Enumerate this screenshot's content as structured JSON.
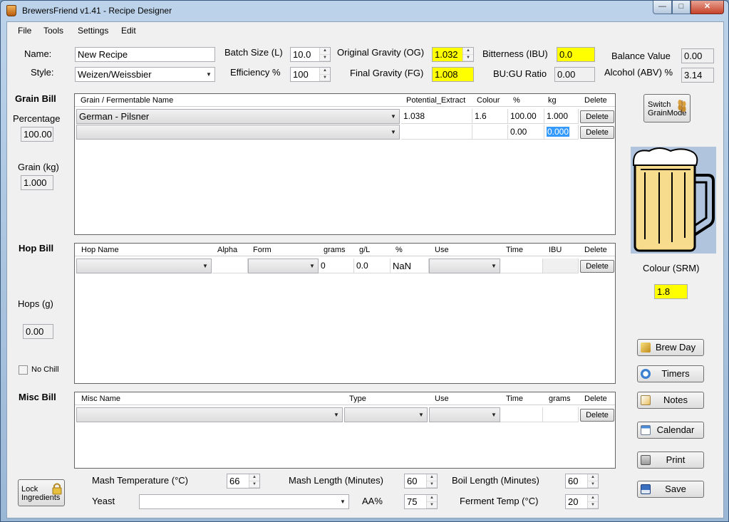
{
  "window": {
    "title": "BrewersFriend v1.41 - Recipe Designer",
    "minimize": "—",
    "maximize": "□",
    "close": "✕"
  },
  "menu": [
    "File",
    "Tools",
    "Settings",
    "Edit"
  ],
  "recipe": {
    "name_label": "Name:",
    "name_value": "New Recipe",
    "style_label": "Style:",
    "style_value": "Weizen/Weissbier",
    "batch_label": "Batch Size (L)",
    "batch_value": "10.0",
    "eff_label": "Efficiency %",
    "eff_value": "100",
    "og_label": "Original Gravity (OG)",
    "og_value": "1.032",
    "fg_label": "Final Gravity (FG)",
    "fg_value": "1.008",
    "ibu_label": "Bitterness (IBU)",
    "ibu_value": "0.0",
    "bugu_label": "BU:GU Ratio",
    "bugu_value": "0.00",
    "balance_label": "Balance Value",
    "balance_value": "0.00",
    "abv_label": "Alcohol (ABV) %",
    "abv_value": "3.14"
  },
  "grain": {
    "title": "Grain Bill",
    "pct_label": "Percentage",
    "pct_value": "100.00",
    "kg_label": "Grain (kg)",
    "kg_value": "1.000",
    "columns": [
      "Grain / Fermentable Name",
      "Potential_Extract",
      "Colour",
      "%",
      "kg",
      "Delete"
    ],
    "rows": [
      {
        "name": "German - Pilsner",
        "extract": "1.038",
        "colour": "1.6",
        "pct": "100.00",
        "kg": "1.000",
        "delete": "Delete"
      },
      {
        "name": "",
        "extract": "",
        "colour": "",
        "pct": "0.00",
        "kg": "0.000",
        "delete": "Delete"
      }
    ]
  },
  "hop": {
    "title": "Hop Bill",
    "hops_label": "Hops (g)",
    "hops_value": "0.00",
    "nochill": "No Chill",
    "columns": [
      "Hop Name",
      "Alpha",
      "Form",
      "grams",
      "g/L",
      "%",
      "Use",
      "Time",
      "IBU",
      "Delete"
    ],
    "row": {
      "grams": "0",
      "gl": "0.0",
      "pct": "NaN",
      "delete": "Delete"
    }
  },
  "misc": {
    "title": "Misc Bill",
    "columns": [
      "Misc Name",
      "Type",
      "Use",
      "Time",
      "grams",
      "Delete"
    ],
    "row": {
      "delete": "Delete"
    }
  },
  "side": {
    "switch_line1": "Switch",
    "switch_line2": "GrainMode",
    "colour_label": "Colour (SRM)",
    "colour_value": "1.8",
    "buttons": [
      "Brew Day",
      "Timers",
      "Notes",
      "Calendar",
      "Print",
      "Save"
    ]
  },
  "bottom": {
    "lock_line1": "Lock",
    "lock_line2": "Ingredients",
    "mash_temp_label": "Mash Temperature (°C)",
    "mash_temp_value": "66",
    "mash_len_label": "Mash Length (Minutes)",
    "mash_len_value": "60",
    "boil_len_label": "Boil Length (Minutes)",
    "boil_len_value": "60",
    "yeast_label": "Yeast",
    "yeast_value": "",
    "aa_label": "AA%",
    "aa_value": "75",
    "ferment_label": "Ferment Temp (°C)",
    "ferment_value": "20"
  },
  "colors": {
    "highlight": "#ffff00",
    "beer": "#f6dc8c",
    "beer_bg": "#b0c4de",
    "selection": "#3399ff"
  }
}
